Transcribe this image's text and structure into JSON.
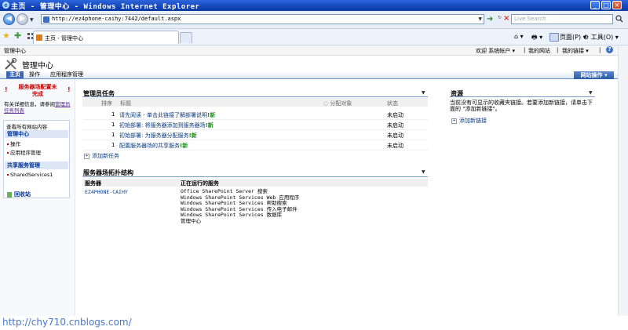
{
  "window": {
    "title": "主页 - 管理中心 - Windows Internet Explorer"
  },
  "address_bar": {
    "url": "http://ez4phone-caihy:7442/default.aspx",
    "search_placeholder": "Live Search"
  },
  "tabs": [
    {
      "label": "主页 - 管理中心"
    }
  ],
  "toolbar": {
    "page_label": "页面(P)",
    "tools_label": "工具(O)"
  },
  "sp_top": {
    "site_name": "管理中心",
    "welcome": "欢迎 系统帐户 ▾",
    "my_site": "我的网站",
    "my_links": "我的链接 ▾"
  },
  "sp_header": {
    "title": "管理中心"
  },
  "sp_tabs": [
    {
      "label": "主页",
      "selected": true
    },
    {
      "label": "操作",
      "selected": false
    },
    {
      "label": "应用程序管理",
      "selected": false
    }
  ],
  "site_actions": "网站操作 ▾",
  "left_nav": {
    "warning_lines": [
      "服务器场配置未",
      "完成"
    ],
    "info_prefix": "有关详细信息，请参阅",
    "info_link": "管理员任务列表",
    "view_all": "查看所有网站内容",
    "sections": [
      {
        "heading": "管理中心",
        "items": [
          "操作",
          "应用程序管理"
        ]
      },
      {
        "heading": "共享服务管理",
        "items": [
          "SharedServices1"
        ]
      }
    ],
    "recycle_bin": "回收站"
  },
  "admin_tasks": {
    "title": "管理员任务",
    "columns": {
      "order": "排序",
      "title": "标题",
      "assigned": "分配对象",
      "status": "状态"
    },
    "rows": [
      {
        "order": "1",
        "title": "请先阅读 - 单击此链接了解部署说明",
        "new": "新",
        "status": "未启动"
      },
      {
        "order": "1",
        "title": "初始部署: 将服务器添加到服务器场",
        "new": "新",
        "status": "未启动"
      },
      {
        "order": "1",
        "title": "初始部署: 为服务器分配服务",
        "new": "新",
        "status": "未启动"
      },
      {
        "order": "1",
        "title": "配置服务器场的共享服务",
        "new": "新",
        "status": "未启动"
      }
    ],
    "add_new": "添加新任务"
  },
  "topology": {
    "title": "服务器场拓扑结构",
    "col_server": "服务器",
    "col_services": "正在运行的服务",
    "server": "EZ4PHONE-CAIHY",
    "services": [
      "Office SharePoint Server 搜索",
      "Windows SharePoint Services Web 应用程序",
      "Windows SharePoint Services 帮助搜索",
      "Windows SharePoint Services 传入电子邮件",
      "Windows SharePoint Services 数据库",
      "管理中心"
    ]
  },
  "resources": {
    "title": "资源",
    "empty_text": "当前没有可显示的收藏夹链接。若要添加新链接，请单击下面的 \"添加新链接\"。",
    "add_link": "添加新链接"
  },
  "watermark": "http://chy710.cnblogs.com/",
  "colors": {
    "title_bar": "#1447b9",
    "tab_selected": "#3a68b8",
    "site_actions": "#2c5aa6",
    "warning": "#cc0000",
    "new_tag": "#1e8f1e",
    "watermark": "#4a78c9"
  }
}
